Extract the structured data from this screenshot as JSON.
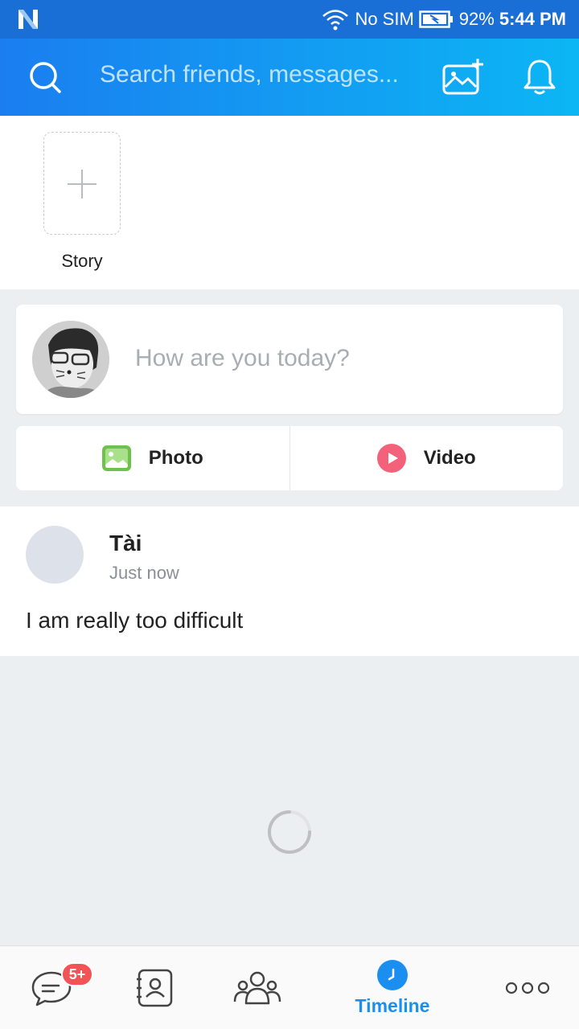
{
  "status_bar": {
    "carrier": "No SIM",
    "battery": "92%",
    "time": "5:44 PM"
  },
  "header": {
    "search_placeholder": "Search friends, messages..."
  },
  "story": {
    "label": "Story"
  },
  "composer": {
    "prompt": "How are you today?"
  },
  "actions": {
    "photo_label": "Photo",
    "video_label": "Video"
  },
  "post": {
    "author": "Tài",
    "time": "Just now",
    "body": "I am really too difficult"
  },
  "bottom_nav": {
    "messages_badge": "5+",
    "timeline_label": "Timeline"
  },
  "colors": {
    "accent": "#1a8ff0",
    "badge": "#f05454"
  }
}
